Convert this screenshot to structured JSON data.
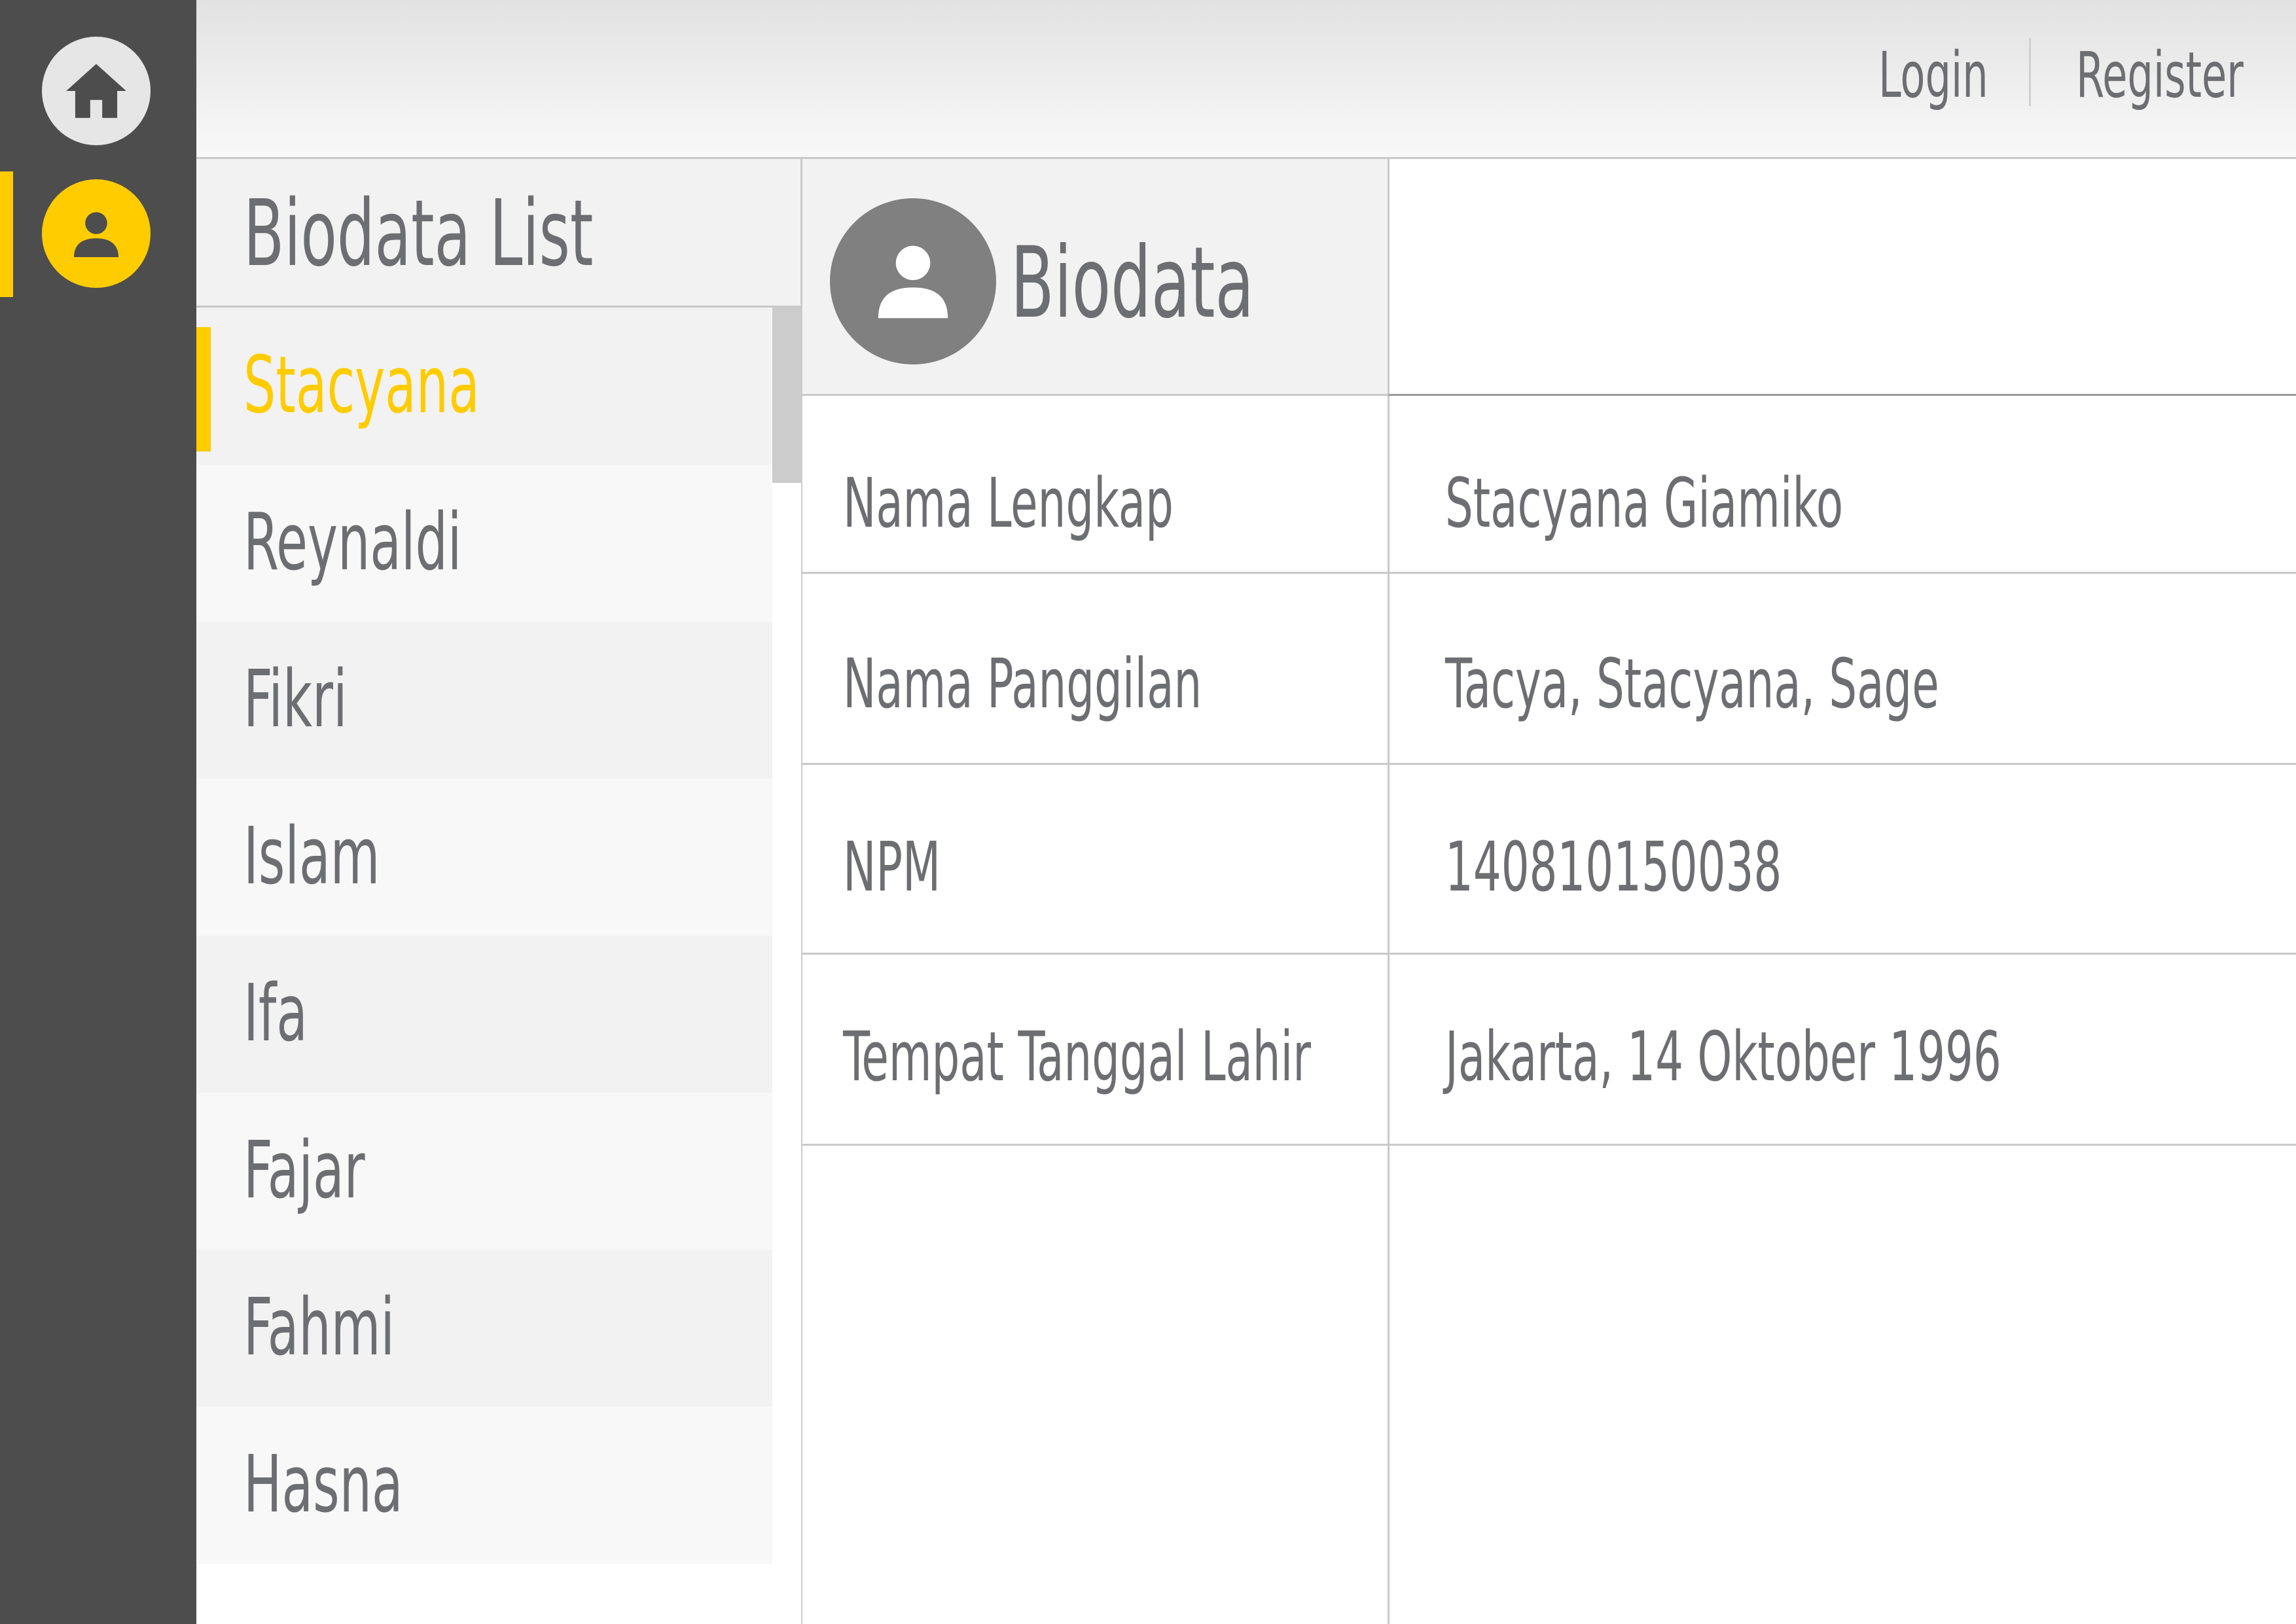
{
  "sidebar": {
    "items": [
      {
        "name": "home",
        "icon": "home-icon",
        "active": false
      },
      {
        "name": "profile",
        "icon": "user-icon",
        "active": true
      }
    ],
    "accent_color": "#ffcc00",
    "background": "#4d4d4d"
  },
  "header": {
    "login_label": "Login",
    "register_label": "Register"
  },
  "list": {
    "title": "Biodata List",
    "items": [
      {
        "name": "Stacyana"
      },
      {
        "name": "Reynaldi"
      },
      {
        "name": "Fikri"
      },
      {
        "name": "Islam"
      },
      {
        "name": "Ifa"
      },
      {
        "name": "Fajar"
      },
      {
        "name": "Fahmi"
      },
      {
        "name": "Hasna"
      }
    ],
    "selected": "Stacyana"
  },
  "detail": {
    "title": "Biodata",
    "avatar_icon": "user-icon",
    "rows": [
      {
        "label": "Nama Lengkap",
        "value": "Stacyana Giamiko"
      },
      {
        "label": "Nama Panggilan",
        "value": "Tacya, Stacyana, Sage"
      },
      {
        "label": "NPM",
        "value": "140810150038"
      },
      {
        "label": "Tempat Tanggal Lahir",
        "value": "Jakarta, 14 Oktober 1996"
      }
    ]
  }
}
